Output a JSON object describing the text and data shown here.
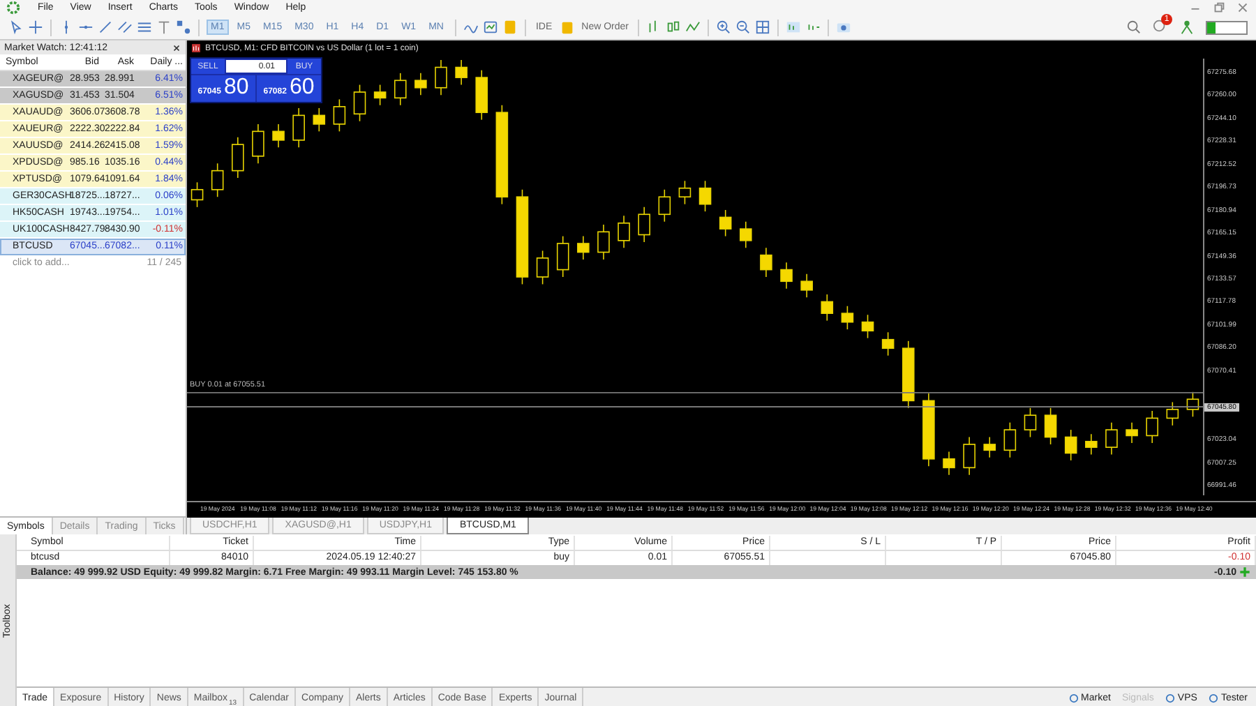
{
  "menu": [
    "File",
    "View",
    "Insert",
    "Charts",
    "Tools",
    "Window",
    "Help"
  ],
  "toolbar": {
    "timeframes": [
      {
        "label": "M1",
        "selected": true
      },
      {
        "label": "M5",
        "selected": false
      },
      {
        "label": "M15",
        "selected": false
      },
      {
        "label": "M30",
        "selected": false
      },
      {
        "label": "H1",
        "selected": false
      },
      {
        "label": "H4",
        "selected": false
      },
      {
        "label": "D1",
        "selected": false
      },
      {
        "label": "W1",
        "selected": false
      },
      {
        "label": "MN",
        "selected": false
      }
    ],
    "ide": "IDE",
    "new_order": "New Order",
    "notifications": "1"
  },
  "market_watch": {
    "title": "Market Watch: 12:41:12",
    "columns": [
      "Symbol",
      "Bid",
      "Ask",
      "Daily ..."
    ],
    "rows": [
      {
        "symbol": "XAGEUR@",
        "bid": "28.953",
        "ask": "28.991",
        "daily": "6.41%",
        "negative": false,
        "color": "#c8c8c8",
        "selected": false
      },
      {
        "symbol": "XAGUSD@",
        "bid": "31.453",
        "ask": "31.504",
        "daily": "6.51%",
        "negative": false,
        "color": "#c8c8c8",
        "selected": false
      },
      {
        "symbol": "XAUAUD@",
        "bid": "3606.07",
        "ask": "3608.78",
        "daily": "1.36%",
        "negative": false,
        "color": "#fbf6c8",
        "selected": false
      },
      {
        "symbol": "XAUEUR@",
        "bid": "2222.30",
        "ask": "2222.84",
        "daily": "1.62%",
        "negative": false,
        "color": "#fbf6c8",
        "selected": false
      },
      {
        "symbol": "XAUUSD@",
        "bid": "2414.26",
        "ask": "2415.08",
        "daily": "1.59%",
        "negative": false,
        "color": "#fbf6c8",
        "selected": false
      },
      {
        "symbol": "XPDUSD@",
        "bid": "985.16",
        "ask": "1035.16",
        "daily": "0.44%",
        "negative": false,
        "color": "#fbf6c8",
        "selected": false
      },
      {
        "symbol": "XPTUSD@",
        "bid": "1079.64",
        "ask": "1091.64",
        "daily": "1.84%",
        "negative": false,
        "color": "#fbf6c8",
        "selected": false
      },
      {
        "symbol": "GER30CASH",
        "bid": "18725...",
        "ask": "18727...",
        "daily": "0.06%",
        "negative": false,
        "color": "#dcf4f8",
        "selected": false
      },
      {
        "symbol": "HK50CASH",
        "bid": "19743...",
        "ask": "19754...",
        "daily": "1.01%",
        "negative": false,
        "color": "#dcf4f8",
        "selected": false
      },
      {
        "symbol": "UK100CASH",
        "bid": "8427.79",
        "ask": "8430.90",
        "daily": "-0.11%",
        "negative": true,
        "color": "#dcf4f8",
        "selected": false
      },
      {
        "symbol": "BTCUSD",
        "bid": "67045...",
        "ask": "67082...",
        "daily": "0.11%",
        "negative": false,
        "color": "#dbe6f6",
        "selected": true
      }
    ],
    "add_hint": "click to add...",
    "count": "11 / 245",
    "tabs": [
      {
        "label": "Symbols",
        "selected": true
      },
      {
        "label": "Details",
        "selected": false
      },
      {
        "label": "Trading",
        "selected": false
      },
      {
        "label": "Ticks",
        "selected": false
      }
    ]
  },
  "chart": {
    "title": "BTCUSD, M1:  CFD BITCOIN vs US Dollar (1 lot = 1 coin)",
    "trade_panel": {
      "sell": "SELL",
      "buy": "BUY",
      "volume": "0.01",
      "sell_small": "67045",
      "sell_big": "80",
      "buy_small": "67082",
      "buy_big": "60"
    },
    "current_price": "67045.80",
    "chart_data": {
      "type": "candlestick",
      "ylim": [
        66985,
        67285
      ],
      "yticks": [
        {
          "value": 67275.68,
          "label": "67275.68"
        },
        {
          "value": 67260.0,
          "label": "67260.00"
        },
        {
          "value": 67244.1,
          "label": "67244.10"
        },
        {
          "value": 67228.31,
          "label": "67228.31"
        },
        {
          "value": 67212.52,
          "label": "67212.52"
        },
        {
          "value": 67196.73,
          "label": "67196.73"
        },
        {
          "value": 67180.94,
          "label": "67180.94"
        },
        {
          "value": 67165.15,
          "label": "67165.15"
        },
        {
          "value": 67149.36,
          "label": "67149.36"
        },
        {
          "value": 67133.57,
          "label": "67133.57"
        },
        {
          "value": 67117.78,
          "label": "67117.78"
        },
        {
          "value": 67101.99,
          "label": "67101.99"
        },
        {
          "value": 67086.2,
          "label": "67086.20"
        },
        {
          "value": 67070.41,
          "label": "67070.41"
        },
        {
          "value": 67023.04,
          "label": "67023.04"
        },
        {
          "value": 67007.25,
          "label": "67007.25"
        },
        {
          "value": 66991.46,
          "label": "66991.46"
        }
      ],
      "categories": [
        null,
        "19 May 2024",
        null,
        "19 May 11:08",
        null,
        "19 May 11:12",
        null,
        "19 May 11:16",
        null,
        "19 May 11:20",
        null,
        "19 May 11:24",
        null,
        "19 May 11:28",
        null,
        "19 May 11:32",
        null,
        "19 May 11:36",
        null,
        "19 May 11:40",
        null,
        "19 May 11:44",
        null,
        "19 May 11:48",
        null,
        "19 May 11:52",
        null,
        "19 May 11:56",
        null,
        "19 May 12:00",
        null,
        "19 May 12:04",
        null,
        "19 May 12:08",
        null,
        "19 May 12:12",
        null,
        "19 May 12:16",
        null,
        "19 May 12:20",
        null,
        "19 May 12:24",
        null,
        "19 May 12:28",
        null,
        "19 May 12:32",
        null,
        "19 May 12:36",
        null,
        "19 May 12:40"
      ],
      "ohlc": [
        [
          67188,
          67200,
          67183,
          67195
        ],
        [
          67195,
          67213,
          67190,
          67208
        ],
        [
          67208,
          67231,
          67203,
          67226
        ],
        [
          67218,
          67240,
          67213,
          67235
        ],
        [
          67235,
          67240,
          67224,
          67229
        ],
        [
          67229,
          67251,
          67224,
          67246
        ],
        [
          67246,
          67251,
          67235,
          67240
        ],
        [
          67240,
          67257,
          67235,
          67252
        ],
        [
          67247,
          67267,
          67242,
          67262
        ],
        [
          67262,
          67267,
          67253,
          67258
        ],
        [
          67258,
          67275,
          67253,
          67270
        ],
        [
          67270,
          67275,
          67260,
          67265
        ],
        [
          67265,
          67284,
          67260,
          67279
        ],
        [
          67279,
          67284,
          67267,
          67272
        ],
        [
          67272,
          67277,
          67243,
          67248
        ],
        [
          67248,
          67253,
          67185,
          67190
        ],
        [
          67190,
          67195,
          67130,
          67135
        ],
        [
          67135,
          67153,
          67130,
          67148
        ],
        [
          67140,
          67163,
          67135,
          67158
        ],
        [
          67158,
          67163,
          67147,
          67152
        ],
        [
          67152,
          67171,
          67147,
          67166
        ],
        [
          67160,
          67177,
          67155,
          67172
        ],
        [
          67164,
          67183,
          67159,
          67178
        ],
        [
          67178,
          67195,
          67173,
          67190
        ],
        [
          67190,
          67201,
          67185,
          67196
        ],
        [
          67196,
          67201,
          67180,
          67185
        ],
        [
          67176,
          67181,
          67163,
          67168
        ],
        [
          67168,
          67173,
          67155,
          67160
        ],
        [
          67150,
          67155,
          67135,
          67140
        ],
        [
          67140,
          67145,
          67127,
          67132
        ],
        [
          67132,
          67137,
          67121,
          67126
        ],
        [
          67118,
          67123,
          67105,
          67110
        ],
        [
          67110,
          67115,
          67099,
          67104
        ],
        [
          67104,
          67109,
          67093,
          67098
        ],
        [
          67092,
          67097,
          67081,
          67086
        ],
        [
          67086,
          67091,
          67045,
          67050
        ],
        [
          67050,
          67055,
          67005,
          67010
        ],
        [
          67010,
          67015,
          66999,
          67004
        ],
        [
          67004,
          67025,
          66999,
          67020
        ],
        [
          67020,
          67025,
          67011,
          67016
        ],
        [
          67016,
          67035,
          67011,
          67030
        ],
        [
          67030,
          67045,
          67025,
          67040
        ],
        [
          67040,
          67045,
          67020,
          67025
        ],
        [
          67025,
          67030,
          67009,
          67014
        ],
        [
          67022,
          67027,
          67013,
          67018
        ],
        [
          67018,
          67035,
          67013,
          67030
        ],
        [
          67030,
          67035,
          67021,
          67026
        ],
        [
          67026,
          67043,
          67021,
          67038
        ],
        [
          67038,
          67049,
          67033,
          67044
        ],
        [
          67044,
          67056,
          67039,
          67051
        ]
      ],
      "ref_lines": [
        {
          "axis": "y",
          "value": 67055.51,
          "label": "BUY 0.01 at 67055.51",
          "color": "#777777"
        },
        {
          "axis": "y",
          "value": 67045.8,
          "color": "#888888"
        }
      ]
    }
  },
  "chart_tabs": [
    {
      "label": "USDCHF,H1",
      "selected": false
    },
    {
      "label": "XAGUSD@,H1",
      "selected": false
    },
    {
      "label": "USDJPY,H1",
      "selected": false
    },
    {
      "label": "BTCUSD,M1",
      "selected": true
    }
  ],
  "toolbox": {
    "label": "Toolbox",
    "columns": [
      "Symbol",
      "Ticket",
      "Time",
      "Type",
      "Volume",
      "Price",
      "S / L",
      "T / P",
      "Price",
      "Profit"
    ],
    "rows": [
      {
        "symbol": "btcusd",
        "ticket": "84010",
        "time": "2024.05.19 12:40:27",
        "type": "buy",
        "volume": "0.01",
        "open_price": "67055.51",
        "current_price": "67045.80",
        "profit": "-0.10",
        "negative": true
      }
    ],
    "summary": "Balance: 49 999.92 USD  Equity: 49 999.82  Margin: 6.71  Free Margin: 49 993.11  Margin Level: 745 153.80 %",
    "total": "-0.10",
    "tabs": [
      {
        "label": "Trade",
        "selected": true
      },
      {
        "label": "Exposure",
        "selected": false
      },
      {
        "label": "History",
        "selected": false
      },
      {
        "label": "News",
        "selected": false
      },
      {
        "label": "Mailbox",
        "badge": "13",
        "selected": false
      },
      {
        "label": "Calendar",
        "selected": false
      },
      {
        "label": "Company",
        "selected": false
      },
      {
        "label": "Alerts",
        "selected": false
      },
      {
        "label": "Articles",
        "selected": false
      },
      {
        "label": "Code Base",
        "selected": false
      },
      {
        "label": "Experts",
        "selected": false
      },
      {
        "label": "Journal",
        "selected": false
      }
    ],
    "services": [
      {
        "label": "Market",
        "disabled": false
      },
      {
        "label": "Signals",
        "disabled": true
      },
      {
        "label": "VPS",
        "disabled": false
      },
      {
        "label": "Tester",
        "disabled": false
      }
    ]
  }
}
